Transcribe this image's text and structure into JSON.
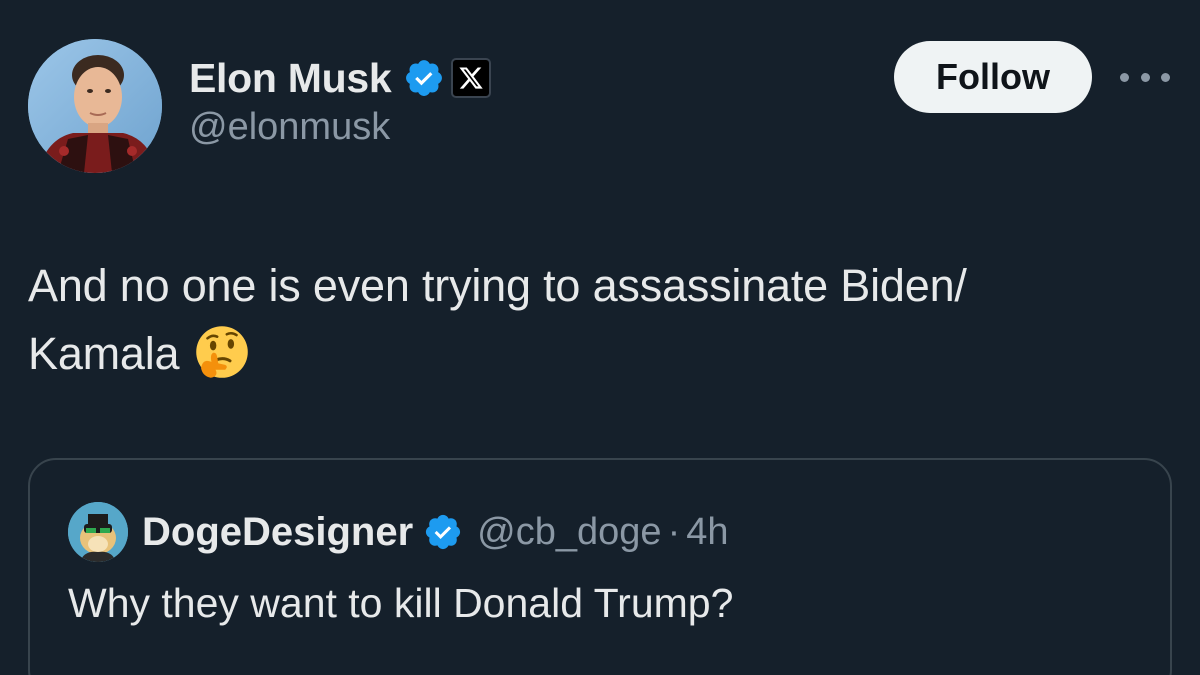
{
  "author": {
    "display_name": "Elon Musk",
    "handle": "@elonmusk",
    "verified_icon": "verified-badge-icon",
    "affiliation_icon": "x-logo-icon"
  },
  "actions": {
    "follow_label": "Follow",
    "more_icon": "more-horizontal-icon"
  },
  "tweet": {
    "text_line1": "And no one is even trying to assassinate Biden/",
    "text_line2": "Kamala",
    "emoji": "thinking-face-emoji"
  },
  "quoted": {
    "display_name": "DogeDesigner",
    "handle": "@cb_doge",
    "separator": "·",
    "time": "4h",
    "text": "Why they want to kill Donald Trump?"
  },
  "colors": {
    "background": "#15202b",
    "text": "#e7e9ea",
    "secondary_text": "#8b98a5",
    "verified_blue": "#1d9bf0",
    "border": "#38444d"
  }
}
